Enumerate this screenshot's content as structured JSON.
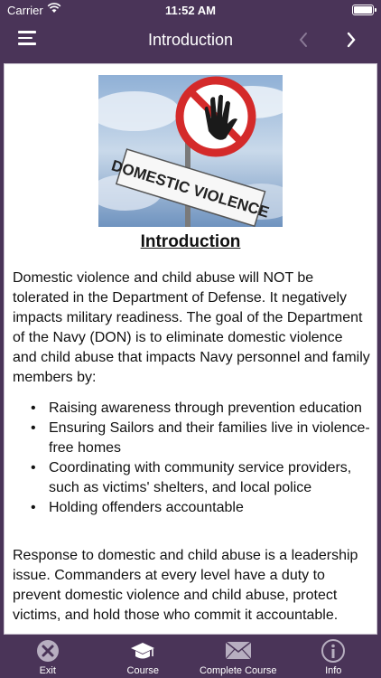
{
  "status_bar": {
    "carrier": "Carrier",
    "time": "11:52 AM"
  },
  "nav": {
    "title": "Introduction",
    "prev_icon": "chevron-left-icon",
    "next_icon": "chevron-right-icon"
  },
  "hero": {
    "sign_text": "DOMESTIC VIOLENCE"
  },
  "content": {
    "heading": "Introduction",
    "paragraph1": "Domestic violence and child abuse will NOT be tolerated in the Department of Defense. It negatively impacts military readiness. The goal of the Department of the Navy (DON) is to eliminate domestic violence and child abuse that impacts Navy personnel and family members by:",
    "bullets": [
      "Raising awareness through prevention education",
      "Ensuring Sailors and their families live in violence-free homes",
      "Coordinating with community service providers, such as victims' shelters, and local police",
      "Holding offenders accountable"
    ],
    "paragraph2": "Response to domestic and child abuse is a leadership issue. Commanders at every level have a duty to prevent domestic violence and child abuse, protect victims, and hold those who commit it accountable."
  },
  "tabs": [
    {
      "label": "Exit",
      "icon": "close-circle-icon"
    },
    {
      "label": "Course",
      "icon": "graduation-cap-icon"
    },
    {
      "label": "Complete Course",
      "icon": "envelope-icon"
    },
    {
      "label": "Info",
      "icon": "info-circle-icon"
    }
  ],
  "colors": {
    "bar_background": "#4a3458",
    "tab_icon": "#b7aec0",
    "sign_red": "#d42a2a"
  }
}
